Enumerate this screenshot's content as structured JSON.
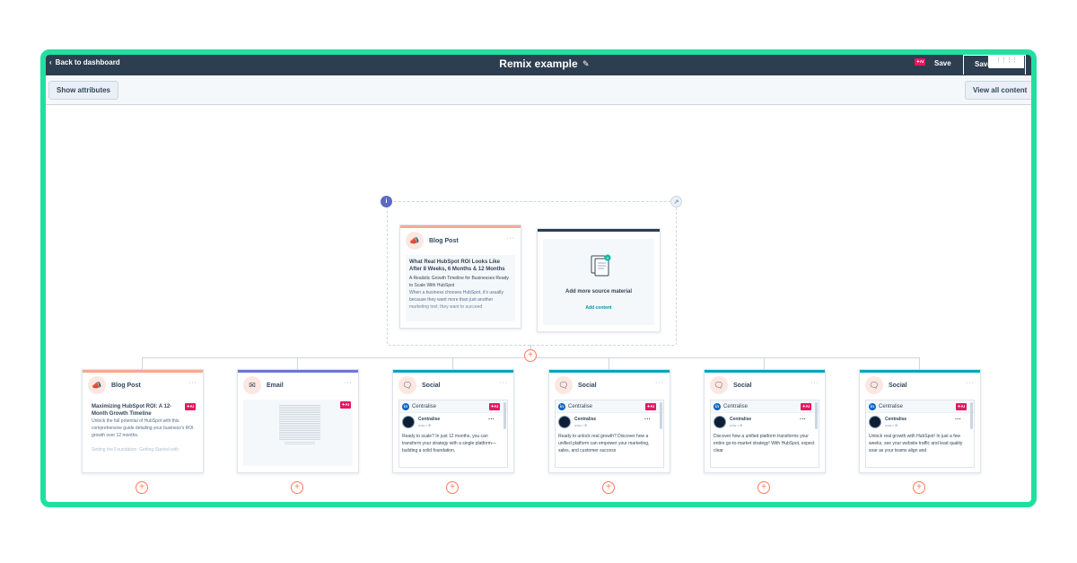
{
  "header": {
    "back_label": "Back to dashboard",
    "title": "Remix example",
    "ai_badge": "✦AI",
    "save_label": "Save",
    "save_button_label": "Save"
  },
  "toolbar": {
    "show_attributes": "Show attributes",
    "view_all_content": "View all content"
  },
  "source": {
    "blog_card": {
      "type": "Blog Post",
      "title": "What Real HubSpot ROI Looks Like After 8 Weeks, 6 Months & 12 Months",
      "subtitle": "A Realistic Growth Timeline for Businesses Ready to Scale With HubSpot",
      "body": "When a business chooses HubSpot, it's usually because they want more than just another marketing tool; they want to succeed"
    },
    "add_source": {
      "label": "Add more source material",
      "link": "Add content"
    }
  },
  "outputs": [
    {
      "type": "Blog Post",
      "title": "Maximizing HubSpot ROI: A 12-Month Growth Timeline",
      "ai_badge": "✦AI",
      "body": "Unlock the full potential of HubSpot with this comprehensive guide detailing your business's ROI growth over 12 months.",
      "body2": "Setting the Foundation: Getting Started with"
    },
    {
      "type": "Email",
      "ai_badge": "✦AI"
    },
    {
      "type": "Social",
      "network": "Centralise",
      "ai_badge": "✦AI",
      "account": "Centralise",
      "meta": "now • ⊕",
      "text": "Ready to scale? In just 12 months, you can transform your strategy with a single platform—building a solid foundation,"
    },
    {
      "type": "Social",
      "network": "Centralise",
      "ai_badge": "✦AI",
      "account": "Centralise",
      "meta": "now • ⊕",
      "text": "Ready to unlock real growth? Discover how a unified platform can empower your marketing, sales, and customer success"
    },
    {
      "type": "Social",
      "network": "Centralise",
      "ai_badge": "✦AI",
      "account": "Centralise",
      "meta": "now • ⊕",
      "text": "Discover how a unified platform transforms your entire go-to-market strategy! With HubSpot, expect clear"
    },
    {
      "type": "Social",
      "network": "Centralise",
      "ai_badge": "✦AI",
      "account": "Centralise",
      "meta": "now • ⊕",
      "text": "Unlock real growth with HubSpot! In just a few weeks, see your website traffic and lead quality soar as your teams align and"
    }
  ],
  "colors": {
    "frame": "#20e0a0",
    "header": "#2d3e50",
    "blog_accent": "#f8a796",
    "email_accent": "#6a78d1",
    "social_accent": "#00a4bd",
    "plus": "#ff7a59",
    "ai_badge": "#e5175e"
  },
  "icons": {
    "back": "chevron-left-icon",
    "edit": "pencil-icon",
    "blog": "megaphone-icon",
    "email": "envelope-icon",
    "social": "chat-bubble-icon",
    "linkedin": "linkedin-icon",
    "add": "plus-icon"
  }
}
